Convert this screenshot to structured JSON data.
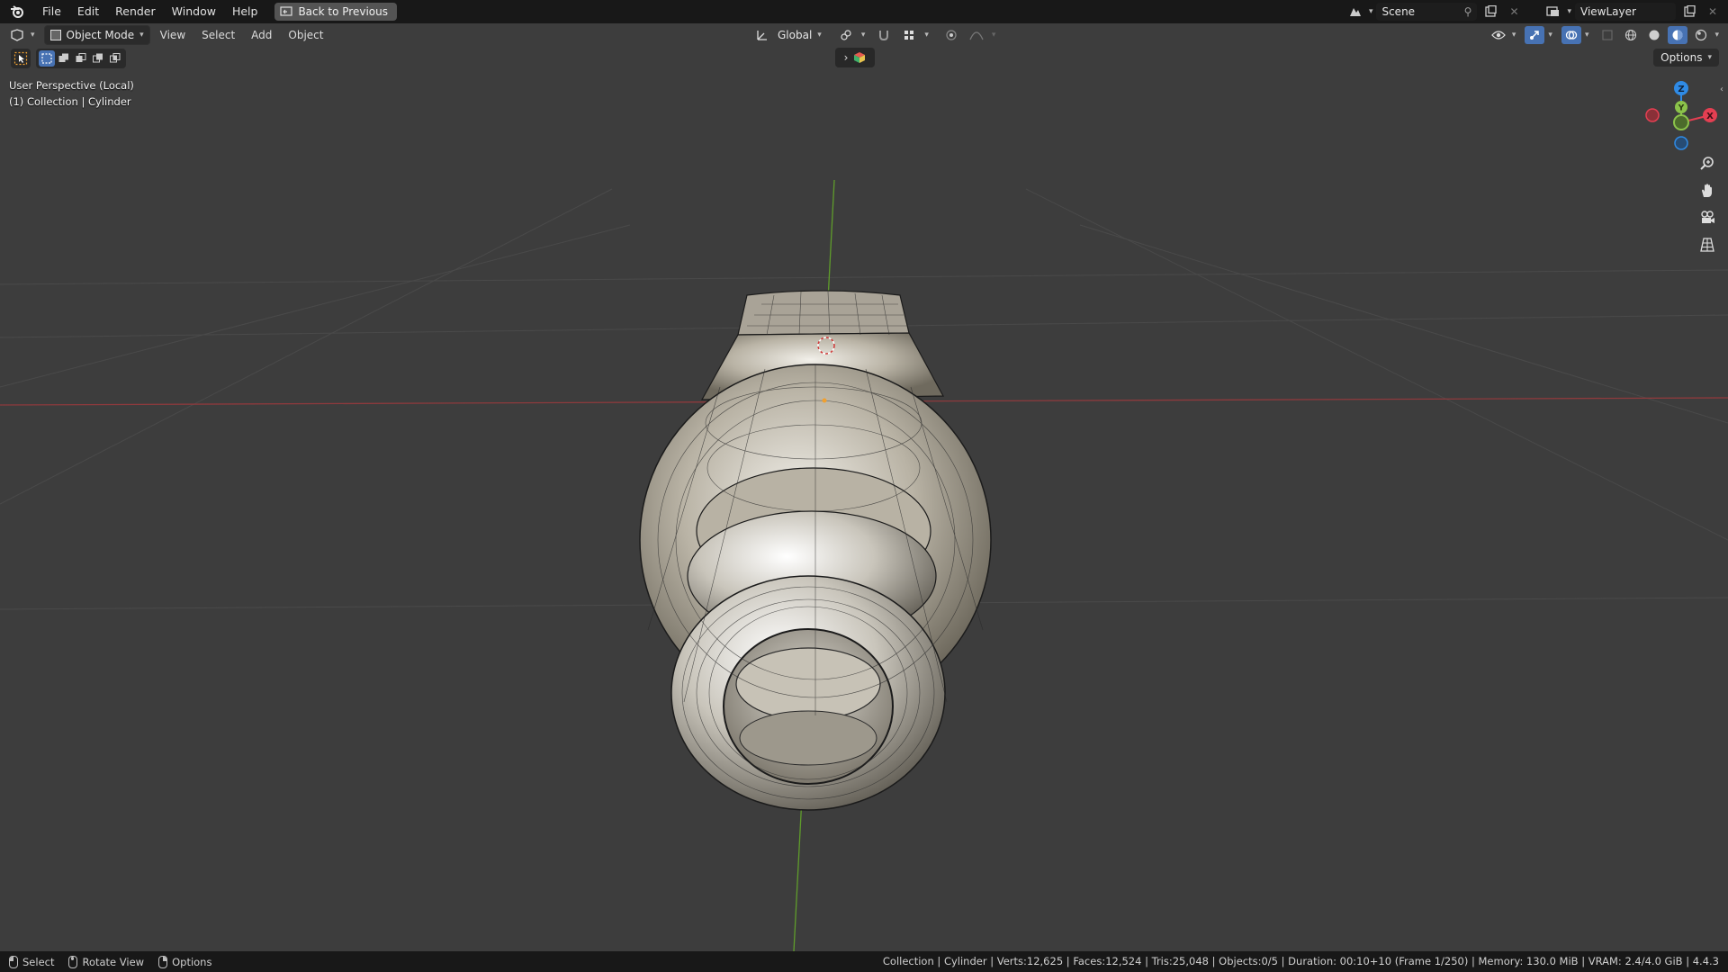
{
  "menubar": {
    "items": [
      "File",
      "Edit",
      "Render",
      "Window",
      "Help"
    ],
    "back_button": "Back to Previous",
    "scene_label": "Scene",
    "viewlayer_label": "ViewLayer"
  },
  "viewport_header": {
    "mode_label": "Object Mode",
    "menus": [
      "View",
      "Select",
      "Add",
      "Object"
    ],
    "transform_orientation": "Global",
    "options_label": "Options"
  },
  "overlay": {
    "view_name": "User Perspective (Local)",
    "collection_object": "(1) Collection | Cylinder"
  },
  "gizmo": {
    "z_label": "Z",
    "y_label": "Y",
    "x_label": "X",
    "colors": {
      "x": "#e43f52",
      "y": "#8bc34a",
      "z": "#2f8be6"
    }
  },
  "statusbar": {
    "hints": [
      "Select",
      "Rotate View",
      "Options"
    ],
    "stats": "Collection | Cylinder | Verts:12,625 | Faces:12,524 | Tris:25,048 | Objects:0/5 | Duration: 00:10+10 (Frame 1/250) | Memory: 130.0 MiB | VRAM: 2.4/4.0 GiB | 4.4.3"
  },
  "colors": {
    "viewport_bg": "#3d3d3d",
    "bar_bg": "#181818",
    "accent": "#4772b3",
    "x_axis": "#b0393e",
    "y_axis": "#5f9c2b"
  }
}
